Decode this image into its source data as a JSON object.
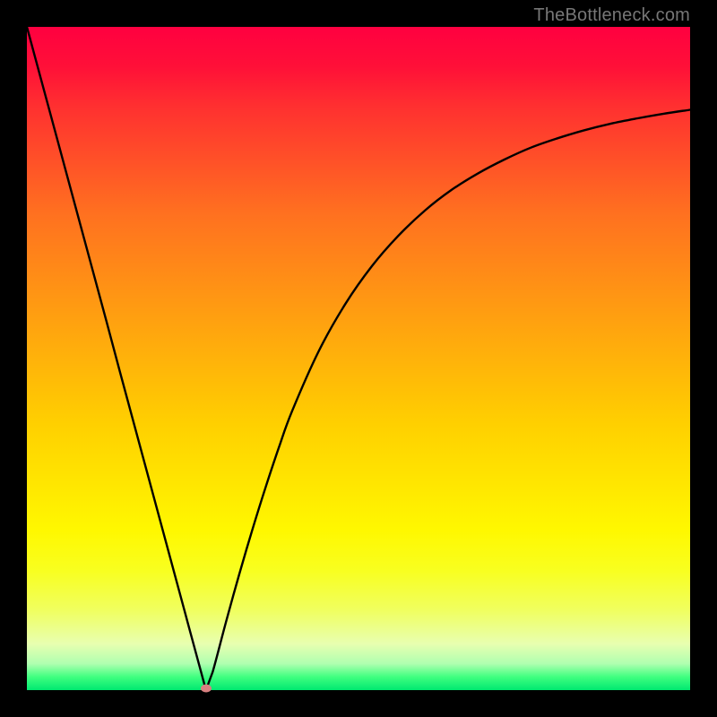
{
  "watermark": "TheBottleneck.com",
  "colors": {
    "page_bg": "#000000",
    "curve": "#000000",
    "min_marker": "#d98080",
    "gradient_top": "#ff0040",
    "gradient_bottom": "#00e870"
  },
  "chart_data": {
    "type": "line",
    "title": "",
    "xlabel": "",
    "ylabel": "",
    "xlim": [
      0,
      100
    ],
    "ylim": [
      0,
      100
    ],
    "grid": false,
    "legend": false,
    "series": [
      {
        "name": "bottleneck-curve",
        "x": [
          0,
          2,
          4,
          6,
          8,
          10,
          12,
          14,
          16,
          18,
          20,
          22,
          24,
          26,
          27,
          28,
          30,
          32,
          34,
          36,
          38,
          40,
          44,
          48,
          52,
          56,
          60,
          64,
          68,
          72,
          76,
          80,
          84,
          88,
          92,
          96,
          100
        ],
        "y": [
          100,
          92.6,
          85.2,
          77.8,
          70.4,
          63.0,
          55.6,
          48.1,
          40.7,
          33.3,
          25.9,
          18.5,
          11.1,
          3.7,
          0.0,
          2.7,
          10.2,
          17.4,
          24.2,
          30.6,
          36.6,
          42.1,
          51.1,
          58.2,
          63.9,
          68.5,
          72.3,
          75.4,
          77.9,
          80.0,
          81.8,
          83.2,
          84.4,
          85.4,
          86.2,
          86.9,
          87.5
        ]
      }
    ],
    "annotations": [
      {
        "name": "minimum-point",
        "x": 27,
        "y": 0
      }
    ]
  }
}
